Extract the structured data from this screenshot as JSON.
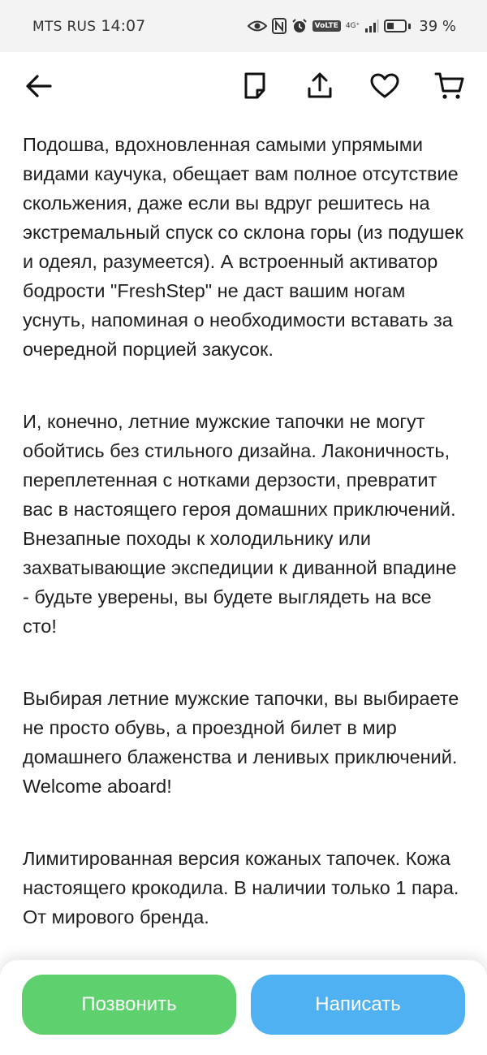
{
  "status_bar": {
    "carrier": "MTS RUS",
    "time": "14:07",
    "volte": "VoLTE",
    "network": "4G⁺",
    "battery_percent": "39 %",
    "battery_level": 0.39
  },
  "nav": {
    "icons": [
      "back-arrow-icon",
      "note-icon",
      "share-icon",
      "heart-icon",
      "cart-icon"
    ]
  },
  "description": {
    "paragraphs": [
      "Подошва, вдохновленная самыми упрямыми видами каучука, обещает вам полное отсутствие скольжения, даже если вы вдруг решитесь на экстремальный спуск со склона горы (из подушек и одеял, разумеется). А встроенный активатор бодрости \"FreshStep\" не даст вашим ногам уснуть, напоминая о необходимости вставать за очередной порцией закусок.",
      "И, конечно, летние мужские тапочки не могут обойтись без стильного дизайна. Лаконичность, переплетенная с нотками дерзости, превратит вас в настоящего героя домашних приключений. Внезапные походы к холодильнику или захватывающие экспедиции к диванной впадине - будьте уверены, вы будете выглядеть на все сто!",
      "Выбирая летние мужские тапочки, вы выбираете не просто обувь, а проездной билет в мир домашнего блаженства и ленивых приключений. Welcome aboard!",
      "Лимитированная версия кожаных тапочек. Кожа настоящего крокодила. В наличии только 1 пара. От мирового бренда."
    ]
  },
  "actions": {
    "call_label": "Позвонить",
    "write_label": "Написать",
    "call_color": "#5fd06e",
    "write_color": "#4fb1f1"
  }
}
